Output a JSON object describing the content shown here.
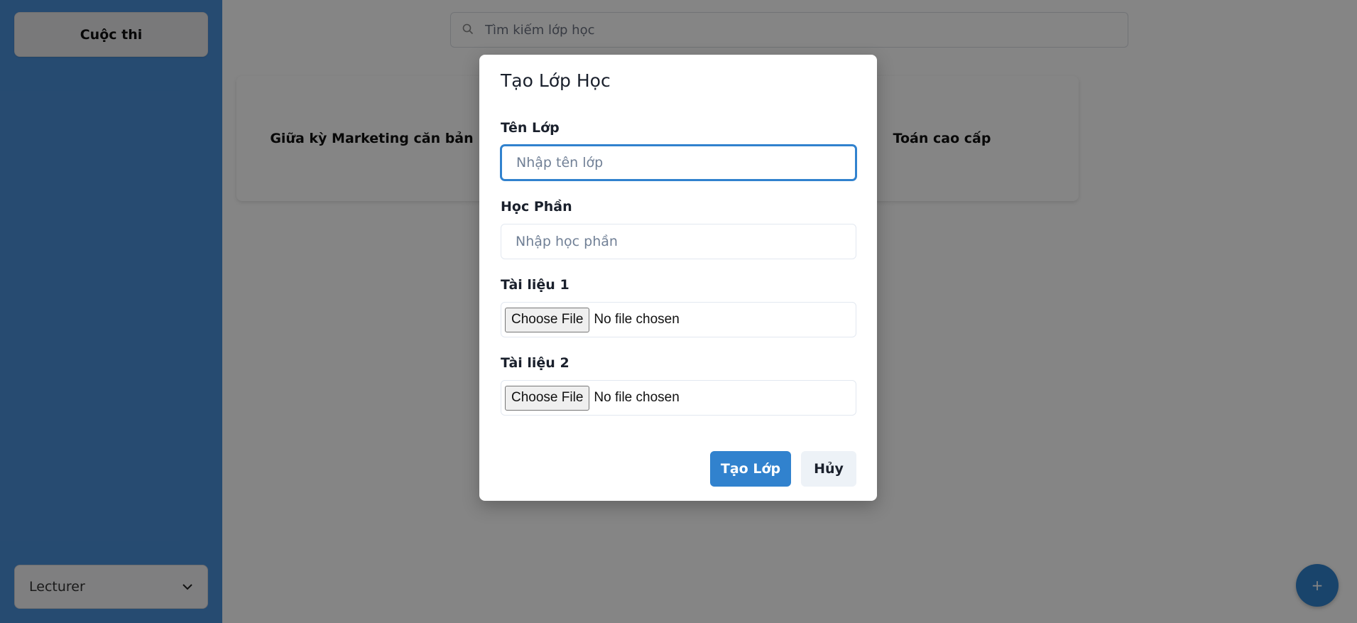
{
  "sidebar": {
    "contest_label": "Cuộc thi",
    "role_value": "Lecturer",
    "role_icon": "chevron-down-icon"
  },
  "main": {
    "search_placeholder": "Tìm kiếm lớp học",
    "cards": [
      {
        "title": "Giữa kỳ Marketing căn bản"
      },
      {
        "title": "Toán cao cấp"
      }
    ],
    "fab_label": "+"
  },
  "modal": {
    "title": "Tạo Lớp Học",
    "class_name_label": "Tên Lớp",
    "class_name_placeholder": "Nhập tên lớp",
    "class_name_value": "",
    "course_label": "Học Phần",
    "course_placeholder": "Nhập học phần",
    "course_value": "",
    "doc1_label": "Tài liệu 1",
    "doc2_label": "Tài liệu 2",
    "file_button_label": "Choose File",
    "file_status": "No file chosen",
    "submit_label": "Tạo Lớp",
    "cancel_label": "Hủy"
  },
  "colors": {
    "sidebar": "#4a90d9",
    "primary": "#3182ce",
    "overlay": "rgba(0,0,0,0.48)"
  }
}
